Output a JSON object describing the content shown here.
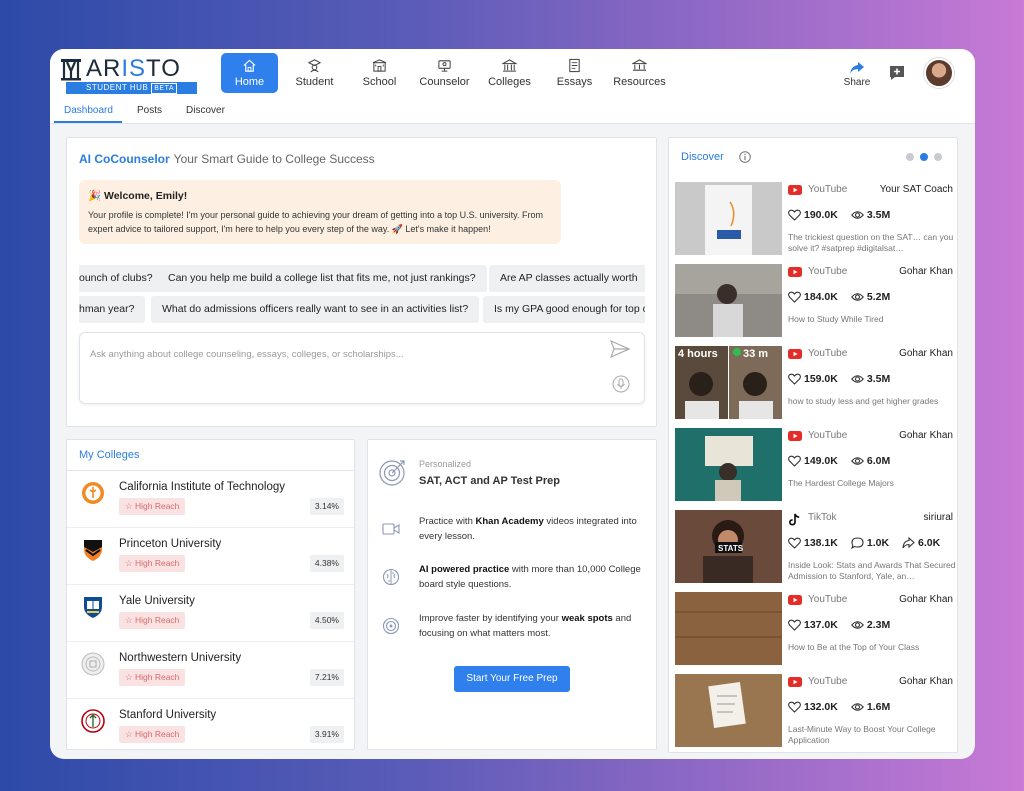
{
  "brand": {
    "name_left": "AR",
    "name_accent": "IS",
    "name_right": "TO",
    "badge": "STUDENT HUB",
    "badge_tag": "BETA"
  },
  "nav": {
    "home": "Home",
    "student": "Student",
    "school": "School",
    "counselor": "Counselor",
    "colleges": "Colleges",
    "essays": "Essays",
    "resources": "Resources"
  },
  "header": {
    "share": "Share"
  },
  "subnav": {
    "dashboard": "Dashboard",
    "posts": "Posts",
    "discover": "Discover"
  },
  "ai": {
    "title": "AI CoCounselor",
    "subtitle": "Your Smart Guide to College Success",
    "welcome_title": "🎉 Welcome, Emily!",
    "welcome_body": "Your profile is complete! I'm your personal guide to achieving your dream of getting into a top U.S. university. From expert advice to tailored support, I'm here to help you every step of the way. 🚀 Let's make it happen!",
    "chips_row1": [
      "ounch of clubs?",
      "Can you help me build a college list that fits me, not just rankings?",
      "Are AP classes actually worth"
    ],
    "chips_row2": [
      "hman year?",
      "What do admissions officers really want to see in an activities list?",
      "Is my GPA good enough for top c"
    ],
    "placeholder": "Ask anything about college counseling, essays, colleges, or scholarships..."
  },
  "colleges": {
    "title": "My Colleges",
    "items": [
      {
        "name": "California Institute of Technology",
        "tag": "☆ High Reach",
        "pct": "3.14%"
      },
      {
        "name": "Princeton University",
        "tag": "☆ High Reach",
        "pct": "4.38%"
      },
      {
        "name": "Yale University",
        "tag": "☆ High Reach",
        "pct": "4.50%"
      },
      {
        "name": "Northwestern University",
        "tag": "☆ High Reach",
        "pct": "7.21%"
      },
      {
        "name": "Stanford University",
        "tag": "☆ High Reach",
        "pct": "3.91%"
      }
    ]
  },
  "prep": {
    "kicker": "Personalized",
    "title": "SAT, ACT and AP Test Prep",
    "item1_a": "Practice with ",
    "item1_b": "Khan Academy",
    "item1_c": " videos integrated into every lesson.",
    "item2_a": "AI powered practice",
    "item2_b": " with more than 10,000 College board style questions.",
    "item3_a": "Improve faster by identifying your ",
    "item3_b": "weak spots",
    "item3_c": " and focusing on what matters most.",
    "button": "Start Your Free Prep"
  },
  "discover": {
    "title": "Discover",
    "videos": [
      {
        "source": "YouTube",
        "channel": "Your SAT Coach",
        "likes": "190.0K",
        "views": "3.5M",
        "desc": "The trickiest question on the SAT… can you solve it? #satprep #digitalsat…"
      },
      {
        "source": "YouTube",
        "channel": "Gohar Khan",
        "likes": "184.0K",
        "views": "5.2M",
        "desc": "How to Study While Tired"
      },
      {
        "source": "YouTube",
        "channel": "Gohar Khan",
        "likes": "159.0K",
        "views": "3.5M",
        "desc": "how to study less and get higher grades",
        "thumb_text1": "4 hours",
        "thumb_text2": "33 m"
      },
      {
        "source": "YouTube",
        "channel": "Gohar Khan",
        "likes": "149.0K",
        "views": "6.0M",
        "desc": "The Hardest College Majors"
      },
      {
        "source": "TikTok",
        "channel": "siriural",
        "likes": "138.1K",
        "comments": "1.0K",
        "shares": "6.0K",
        "desc": "Inside Look: Stats and Awards That Secured Admission to Stanford, Yale, an…",
        "thumb_text1": "STATS"
      },
      {
        "source": "YouTube",
        "channel": "Gohar Khan",
        "likes": "137.0K",
        "views": "2.3M",
        "desc": "How to Be at the Top of Your Class"
      },
      {
        "source": "YouTube",
        "channel": "Gohar Khan",
        "likes": "132.0K",
        "views": "1.6M",
        "desc": "Last-Minute Way to Boost Your College Application"
      }
    ]
  },
  "colors": {
    "accent": "#2a7de1",
    "button": "#2f80ed",
    "welcome_bg": "#fdf0e3",
    "tag_bg": "#fbe2e2",
    "tag_text": "#d46b6b",
    "youtube": "#e52d27"
  }
}
